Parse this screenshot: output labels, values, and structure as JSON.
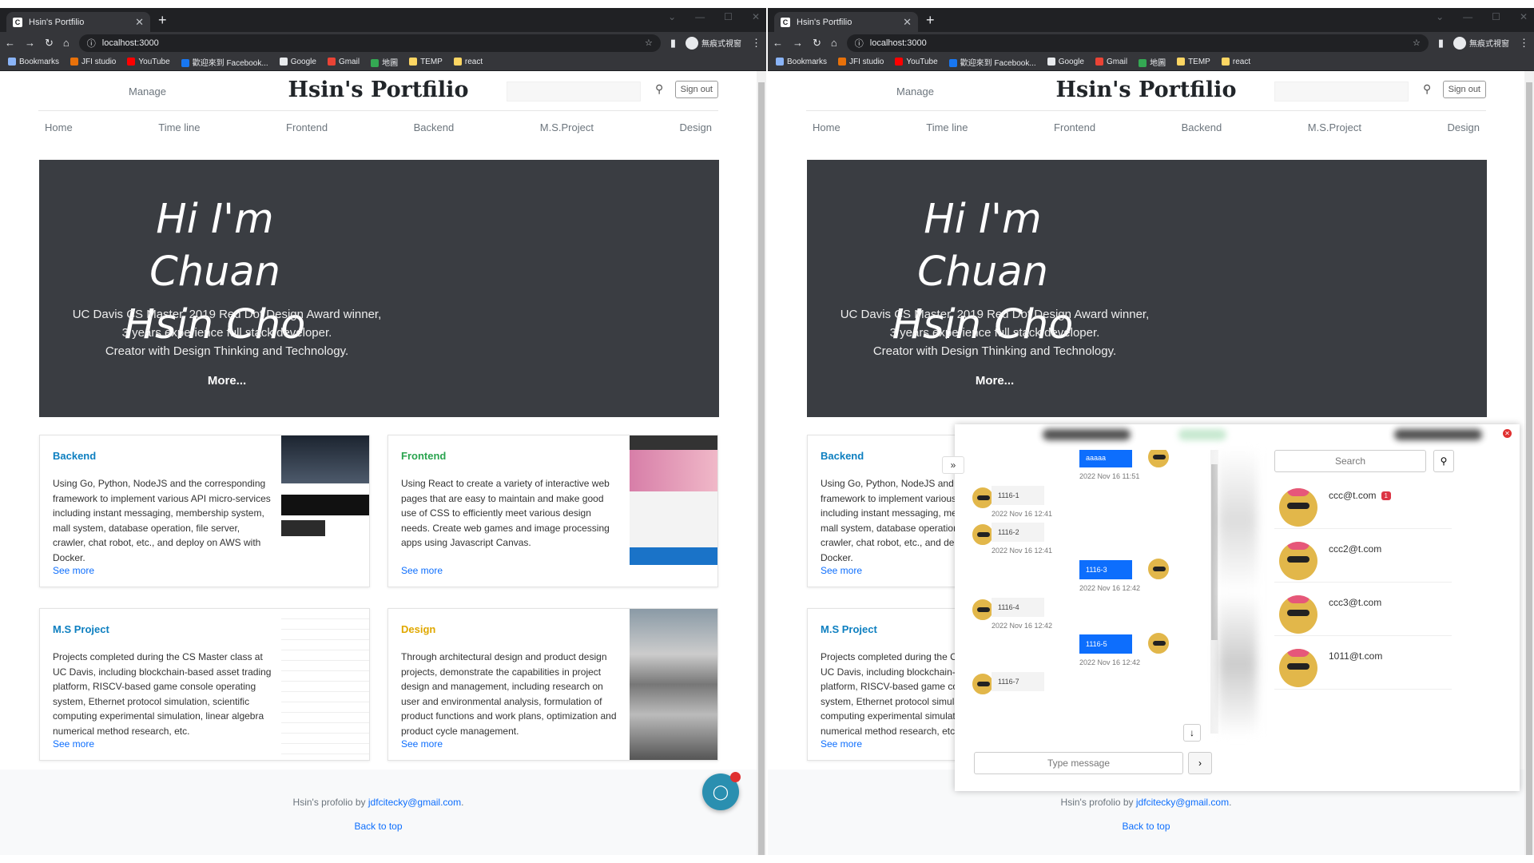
{
  "browser": {
    "tab_title": "Hsin's Portfilio",
    "url": "localhost:3000",
    "profile_label": "無痕式視窗",
    "bookmarks": [
      {
        "label": "Bookmarks",
        "color": "#8ab4f8"
      },
      {
        "label": "JFI studio",
        "color": "#e8710a"
      },
      {
        "label": "YouTube",
        "color": "#ff0000"
      },
      {
        "label": "歡迎來到 Facebook...",
        "color": "#1877f2"
      },
      {
        "label": "Google",
        "color": "#e8eaed"
      },
      {
        "label": "Gmail",
        "color": "#ea4335"
      },
      {
        "label": "地圖",
        "color": "#34a853"
      },
      {
        "label": "TEMP",
        "color": "#fdd663"
      },
      {
        "label": "react",
        "color": "#fdd663"
      }
    ]
  },
  "site": {
    "manage": "Manage",
    "brand": "Hsin's Portfilio",
    "sign_out": "Sign out",
    "nav": [
      "Home",
      "Time line",
      "Frontend",
      "Backend",
      "M.S.Project",
      "Design"
    ],
    "hero": {
      "line1": "Hi I'm Chuan",
      "line2": "Hsin Cho",
      "sub1": "UC Davis CS Master, 2019 Red Dot Design Award winner,",
      "sub2": "3 years experience full stack developer.",
      "sub3": "Creator with Design Thinking and Technology.",
      "more": "More..."
    },
    "cards": [
      {
        "title": "Backend",
        "color": "#0d7fc0",
        "text": "Using Go, Python, NodeJS and the corresponding framework to implement various API micro-services including instant messaging, membership system, mall system, database operation, file server, crawler, chat robot, etc., and deploy on AWS with Docker.",
        "see": "See more"
      },
      {
        "title": "Frontend",
        "color": "#2aa44f",
        "text": "Using React to create a variety of interactive web pages that are easy to maintain and make good use of CSS to efficiently meet various design needs. Create web games and image processing apps using Javascript Canvas.",
        "see": "See more"
      },
      {
        "title": "M.S Project",
        "color": "#0d7fc0",
        "text": "Projects completed during the CS Master class at UC Davis, including blockchain-based asset trading platform, RISCV-based game console operating system, Ethernet protocol simulation, scientific computing experimental simulation, linear algebra numerical method research, etc.",
        "see": "See more"
      },
      {
        "title": "Design",
        "color": "#e0a800",
        "text": "Through architectural design and product design projects, demonstrate the capabilities in project design and management, including research on user and environmental analysis, formulation of product functions and work plans, optimization and product cycle management.",
        "see": "See more"
      }
    ],
    "footer": {
      "prefix": "Hsin's profolio by ",
      "email": "jdfcitecky@gmail.com",
      "suffix": ".",
      "back": "Back to top"
    }
  },
  "chat": {
    "messages": [
      {
        "dir": "out",
        "text": "aaaaa",
        "time": "2022 Nov 16 11:51"
      },
      {
        "dir": "in",
        "text": "1116-1",
        "time": "2022 Nov 16 12:41"
      },
      {
        "dir": "in",
        "text": "1116-2",
        "time": "2022 Nov 16 12:41"
      },
      {
        "dir": "out",
        "text": "1116-3",
        "time": "2022 Nov 16 12:42"
      },
      {
        "dir": "in",
        "text": "1116-4",
        "time": "2022 Nov 16 12:42"
      },
      {
        "dir": "out",
        "text": "1116-5",
        "time": "2022 Nov 16 12:42"
      },
      {
        "dir": "in",
        "text": "1116-7",
        "time": ""
      }
    ],
    "input_placeholder": "Type message",
    "send": "›",
    "search_placeholder": "Search",
    "contacts": [
      {
        "email": "ccc@t.com",
        "badge": "1"
      },
      {
        "email": "ccc2@t.com",
        "badge": ""
      },
      {
        "email": "ccc3@t.com",
        "badge": ""
      },
      {
        "email": "1011@t.com",
        "badge": ""
      }
    ]
  }
}
